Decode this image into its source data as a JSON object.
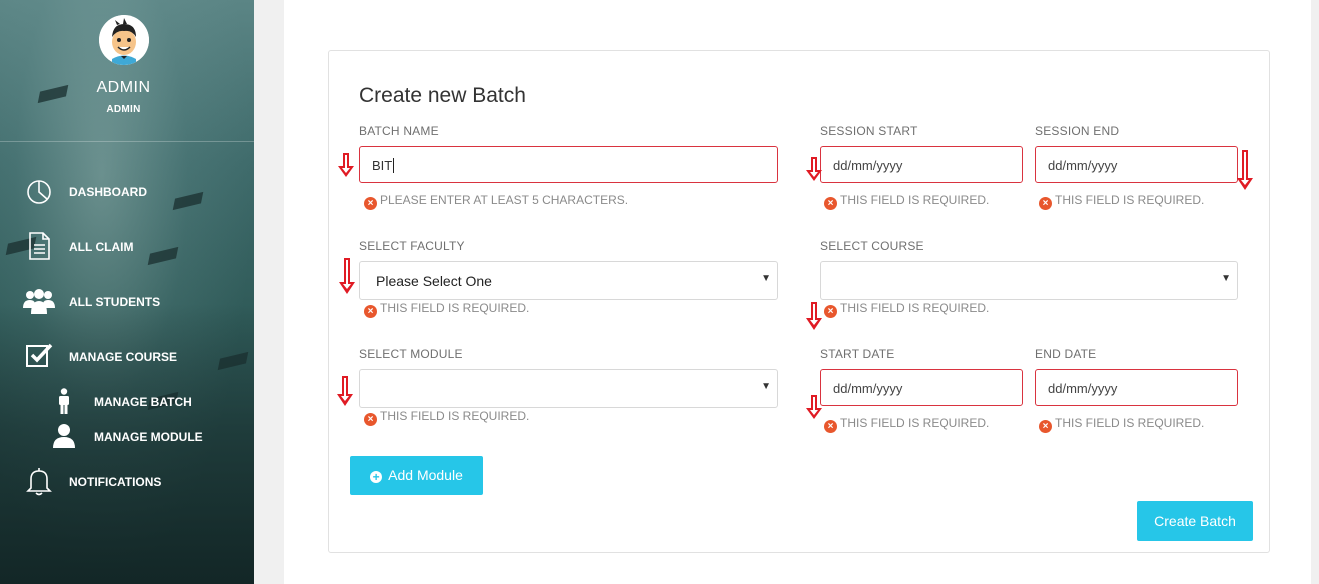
{
  "sidebar": {
    "user_name": "ADMIN",
    "user_role": "ADMIN",
    "items": [
      {
        "label": "DASHBOARD",
        "icon": "pie-chart-icon"
      },
      {
        "label": "ALL CLAIM",
        "icon": "document-icon"
      },
      {
        "label": "ALL STUDENTS",
        "icon": "users-icon"
      },
      {
        "label": "MANAGE COURSE",
        "icon": "checkbox-icon"
      },
      {
        "label": "NOTIFICATIONS",
        "icon": "bell-icon"
      }
    ],
    "sub_items": [
      {
        "label": "MANAGE BATCH",
        "icon": "person-icon"
      },
      {
        "label": "MANAGE MODULE",
        "icon": "user-icon"
      }
    ]
  },
  "form": {
    "title": "Create new Batch",
    "batch_name": {
      "label": "BATCH NAME",
      "value": "BIT",
      "error": "PLEASE ENTER AT LEAST 5 CHARACTERS."
    },
    "session_start": {
      "label": "SESSION START",
      "placeholder": "dd/mm/yyyy",
      "error": "THIS FIELD IS REQUIRED."
    },
    "session_end": {
      "label": "SESSION END",
      "placeholder": "dd/mm/yyyy",
      "error": "THIS FIELD IS REQUIRED."
    },
    "faculty": {
      "label": "SELECT FACULTY",
      "value": "Please Select One",
      "error": "THIS FIELD IS REQUIRED."
    },
    "course": {
      "label": "SELECT COURSE",
      "value": "",
      "error": "THIS FIELD IS REQUIRED."
    },
    "module": {
      "label": "SELECT MODULE",
      "value": "",
      "error": "THIS FIELD IS REQUIRED."
    },
    "start_date": {
      "label": "START DATE",
      "placeholder": "dd/mm/yyyy",
      "error": "THIS FIELD IS REQUIRED."
    },
    "end_date": {
      "label": "END DATE",
      "placeholder": "dd/mm/yyyy",
      "error": "THIS FIELD IS REQUIRED."
    },
    "add_module_label": "Add Module",
    "create_batch_label": "Create Batch"
  },
  "colors": {
    "accent": "#26c6e8",
    "error_border": "#d9333f",
    "error_icon": "#e8572d",
    "annotation_arrow": "#e01b24"
  }
}
